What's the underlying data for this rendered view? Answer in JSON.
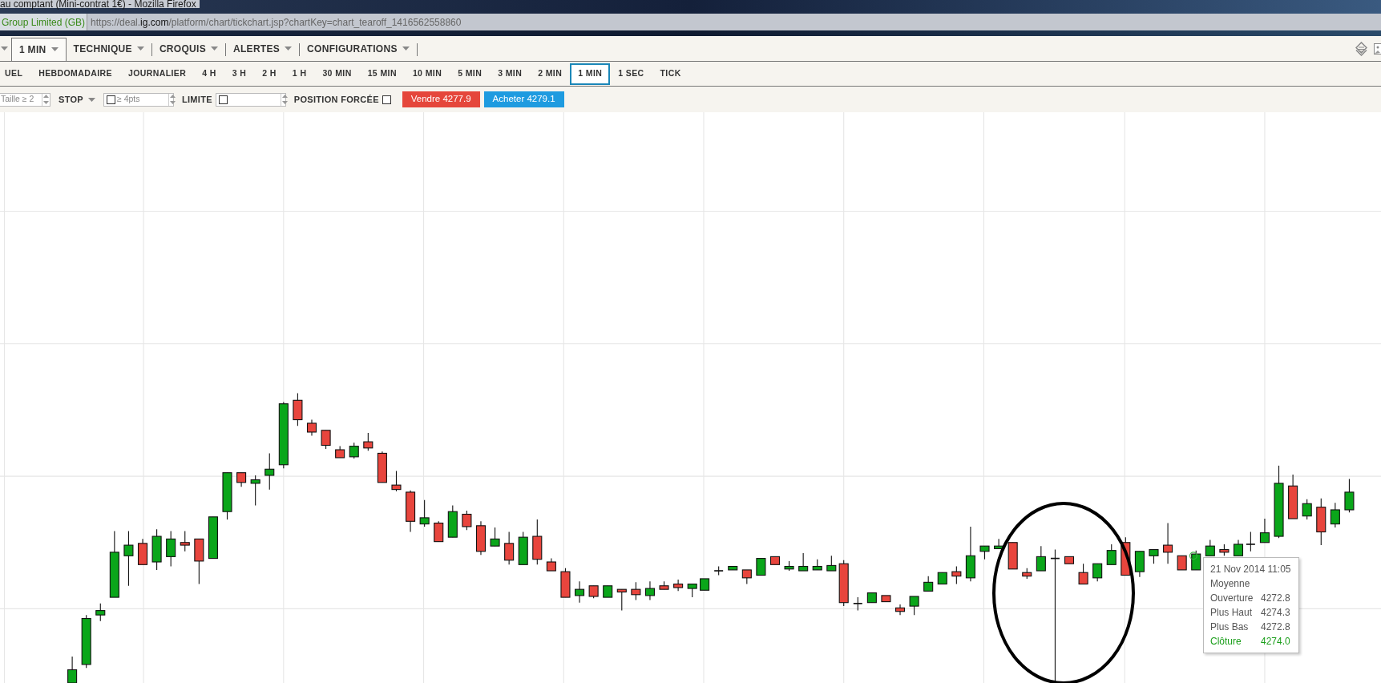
{
  "window": {
    "title": "au comptant (Mini-contrat 1€) - Mozilla Firefox"
  },
  "address_bar": {
    "site_label": "Group Limited (GB)",
    "url_host_prefix": "https://deal.",
    "url_host": "ig.com",
    "url_path": "/platform/chart/tickchart.jsp?chartKey=chart_tearoff_1416562558860"
  },
  "toolbar": {
    "menus": [
      {
        "label": "1 MIN",
        "selected": true
      },
      {
        "label": "TECHNIQUE",
        "selected": false
      },
      {
        "label": "CROQUIS",
        "selected": false
      },
      {
        "label": "ALERTES",
        "selected": false
      },
      {
        "label": "CONFIGURATIONS",
        "selected": false
      }
    ]
  },
  "timeframes": [
    {
      "label": "UEL",
      "selected": false
    },
    {
      "label": "HEBDOMADAIRE",
      "selected": false
    },
    {
      "label": "JOURNALIER",
      "selected": false
    },
    {
      "label": "4 H",
      "selected": false
    },
    {
      "label": "3 H",
      "selected": false
    },
    {
      "label": "2 H",
      "selected": false
    },
    {
      "label": "1 H",
      "selected": false
    },
    {
      "label": "30 MIN",
      "selected": false
    },
    {
      "label": "15 MIN",
      "selected": false
    },
    {
      "label": "10 MIN",
      "selected": false
    },
    {
      "label": "5 MIN",
      "selected": false
    },
    {
      "label": "3 MIN",
      "selected": false
    },
    {
      "label": "2 MIN",
      "selected": false
    },
    {
      "label": "1 MIN",
      "selected": true
    },
    {
      "label": "1 SEC",
      "selected": false
    },
    {
      "label": "TICK",
      "selected": false
    }
  ],
  "order_bar": {
    "size_placeholder": "Taille ≥ 2",
    "stop_label": "STOP",
    "stop_checked": false,
    "stop_placeholder": "≥ 4pts",
    "limit_label": "LIMITE",
    "limit_checked": false,
    "forced_label": "POSITION FORCÉE",
    "forced_checked": false,
    "sell_button": "Vendre 4277.9",
    "buy_button": "Acheter 4279.1"
  },
  "tooltip": {
    "date": "21 Nov 2014 11:05",
    "caption": "Moyenne",
    "rows": [
      {
        "label": "Ouverture",
        "value": "4272.8",
        "highlight": false
      },
      {
        "label": "Plus Haut",
        "value": "4274.3",
        "highlight": false
      },
      {
        "label": "Plus Bas",
        "value": "4272.8",
        "highlight": false
      },
      {
        "label": "Clôture",
        "value": "4274.0",
        "highlight": true
      }
    ]
  }
}
